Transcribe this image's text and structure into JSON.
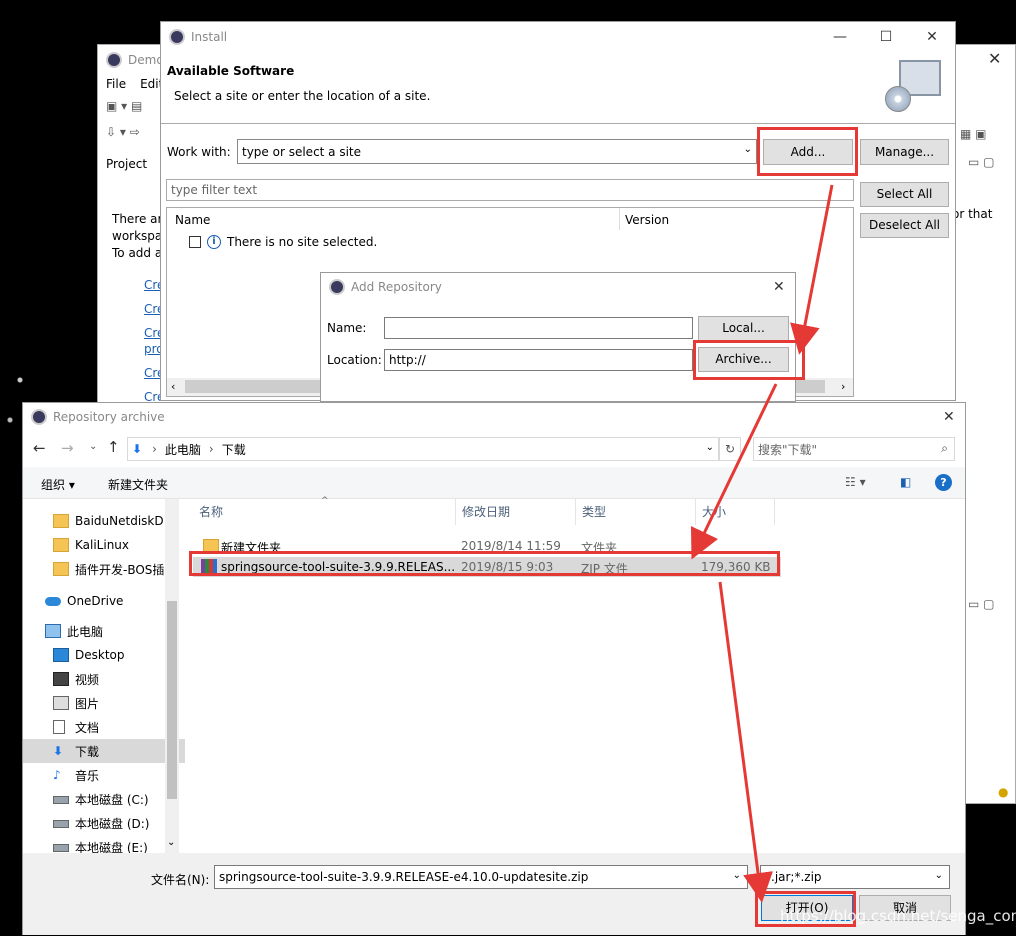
{
  "eclipse": {
    "title": "Demo",
    "menu": [
      "File",
      "Edit"
    ],
    "project_tab": "Project",
    "intro_text": [
      "There are",
      "workspace",
      "To add a"
    ],
    "links": [
      "Cre",
      "Cre",
      "Cre",
      "pro",
      "Cre",
      "Cre"
    ],
    "right_text": "or that"
  },
  "install": {
    "title": "Install",
    "heading": "Available Software",
    "subheading": "Select a site or enter the location of a site.",
    "work_with_label": "Work with:",
    "work_with_value": "type or select a site",
    "add_button": "Add...",
    "manage_button": "Manage...",
    "filter_placeholder": "type filter text",
    "select_all": "Select All",
    "deselect_all": "Deselect All",
    "col_name": "Name",
    "col_version": "Version",
    "no_site": "There is no site selected."
  },
  "add_repo": {
    "title": "Add Repository",
    "name_label": "Name:",
    "name_value": "",
    "location_label": "Location:",
    "location_value": "http://",
    "local_button": "Local...",
    "archive_button": "Archive..."
  },
  "archive": {
    "title": "Repository archive",
    "breadcrumb": [
      "此电脑",
      "下载"
    ],
    "search_placeholder": "搜索\"下载\"",
    "organize": "组织 ▾",
    "new_folder": "新建文件夹",
    "columns": [
      "名称",
      "修改日期",
      "类型",
      "大小"
    ],
    "nav": [
      {
        "label": "BaiduNetdiskD",
        "icon": "folder"
      },
      {
        "label": "KaliLinux",
        "icon": "folder"
      },
      {
        "label": "插件开发-BOS插",
        "icon": "folder"
      },
      {
        "label": "OneDrive",
        "icon": "cloud"
      },
      {
        "label": "此电脑",
        "icon": "pc"
      },
      {
        "label": "Desktop",
        "icon": "desktop"
      },
      {
        "label": "视频",
        "icon": "video"
      },
      {
        "label": "图片",
        "icon": "picture"
      },
      {
        "label": "文档",
        "icon": "document"
      },
      {
        "label": "下载",
        "icon": "download"
      },
      {
        "label": "音乐",
        "icon": "music"
      },
      {
        "label": "本地磁盘 (C:)",
        "icon": "drive"
      },
      {
        "label": "本地磁盘 (D:)",
        "icon": "drive"
      },
      {
        "label": "本地磁盘 (E:)",
        "icon": "drive"
      }
    ],
    "files": [
      {
        "name": "新建文件夹",
        "date": "2019/8/14 11:59",
        "type": "文件夹",
        "size": ""
      },
      {
        "name": "springsource-tool-suite-3.9.9.RELEAS...",
        "date": "2019/8/15 9:03",
        "type": "ZIP 文件",
        "size": "179,360 KB"
      }
    ],
    "filename_label": "文件名(N):",
    "filename_value": "springsource-tool-suite-3.9.9.RELEASE-e4.10.0-updatesite.zip",
    "filter_value": "*.jar;*.zip",
    "open_button": "打开(O)",
    "cancel_button": "取消"
  },
  "watermark": "https://blog.csdn.net/senga_com",
  "colors": {
    "highlight": "#e53935",
    "selection": "#cce8ff",
    "accent": "#1a73e8"
  }
}
